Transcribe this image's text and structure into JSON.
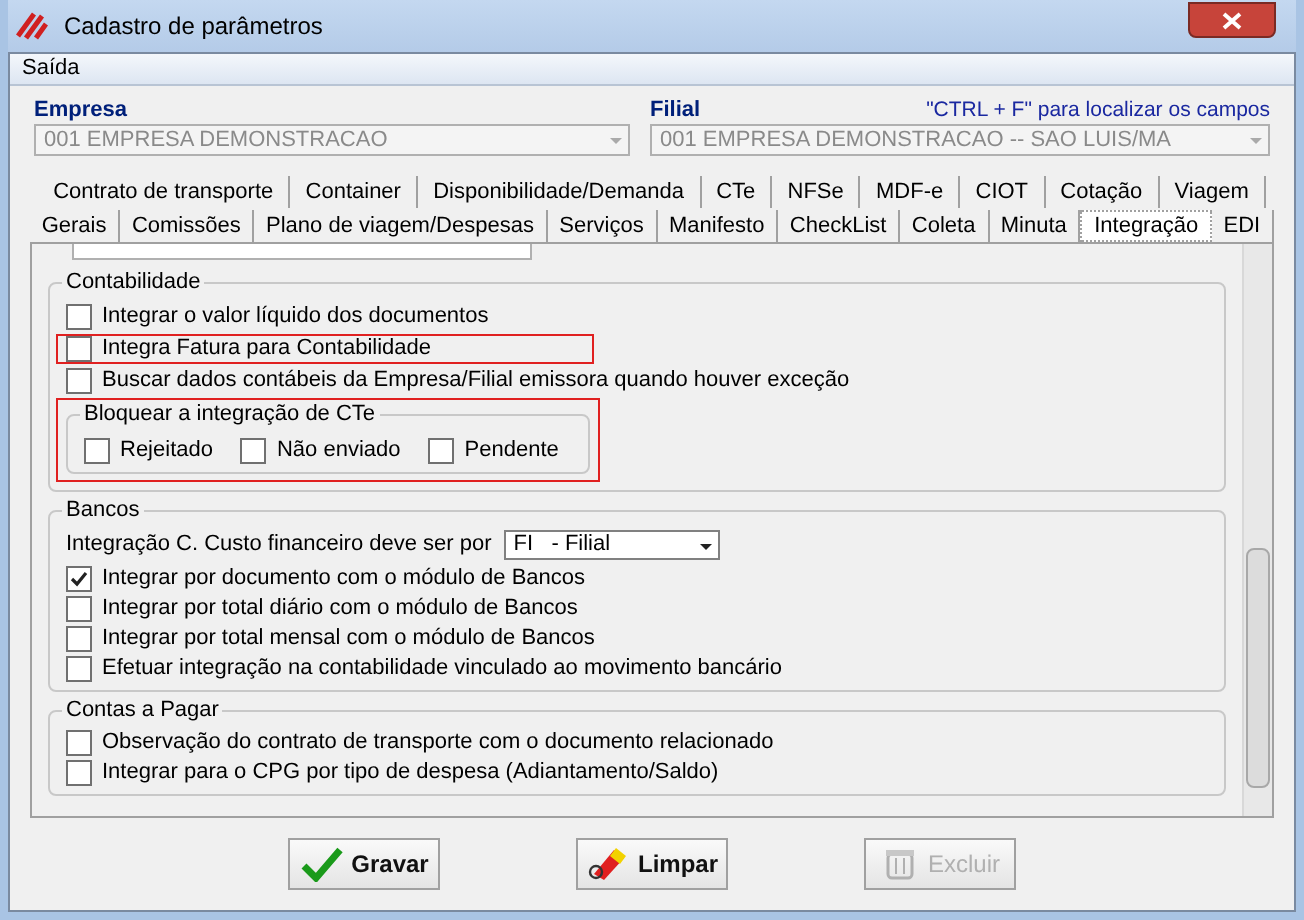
{
  "window": {
    "title": "Cadastro de parâmetros"
  },
  "menu": [
    "Saída"
  ],
  "empresa": {
    "label": "Empresa",
    "value": "001 EMPRESA DEMONSTRACAO"
  },
  "filial": {
    "label": "Filial",
    "value": "001 EMPRESA DEMONSTRACAO -- SAO LUIS/MA",
    "hint": "\"CTRL + F\" para localizar os campos"
  },
  "tabs_row_1": [
    {
      "label": "Contrato de transporte",
      "selected": false
    },
    {
      "label": "Container",
      "selected": false
    },
    {
      "label": "Disponibilidade/Demanda",
      "selected": false
    },
    {
      "label": "CTe",
      "selected": false
    },
    {
      "label": "NFSe",
      "selected": false
    },
    {
      "label": "MDF-e",
      "selected": false
    },
    {
      "label": "CIOT",
      "selected": false
    },
    {
      "label": "Cotação",
      "selected": false
    },
    {
      "label": "Viagem",
      "selected": false
    }
  ],
  "tabs_row_2": [
    {
      "label": "Gerais",
      "selected": false
    },
    {
      "label": "Comissões",
      "selected": false
    },
    {
      "label": "Plano de viagem/Despesas",
      "selected": false
    },
    {
      "label": "Serviços",
      "selected": false
    },
    {
      "label": "Manifesto",
      "selected": false
    },
    {
      "label": "CheckList",
      "selected": false
    },
    {
      "label": "Coleta",
      "selected": false
    },
    {
      "label": "Minuta",
      "selected": false
    },
    {
      "label": "Integração",
      "selected": true
    },
    {
      "label": "EDI",
      "selected": false
    }
  ],
  "contabilidade": {
    "title": "Contabilidade",
    "options": [
      {
        "label": "Integrar o valor líquido dos documentos",
        "checked": false,
        "highlighted": false
      },
      {
        "label": "Integra Fatura para Contabilidade",
        "checked": false,
        "highlighted": true
      },
      {
        "label": "Buscar dados contábeis da Empresa/Filial emissora quando houver exceção",
        "checked": false,
        "highlighted": false
      }
    ],
    "bloquear": {
      "title": "Bloquear a integração de CTe",
      "highlighted": true,
      "options": [
        {
          "label": "Rejeitado",
          "checked": false
        },
        {
          "label": "Não enviado",
          "checked": false
        },
        {
          "label": "Pendente",
          "checked": false
        }
      ]
    }
  },
  "bancos": {
    "title": "Bancos",
    "custo_label": "Integração C. Custo financeiro deve ser por",
    "custo_value": "FI   - Filial",
    "options": [
      {
        "label": "Integrar por documento com o módulo de Bancos",
        "checked": true
      },
      {
        "label": "Integrar por total diário com o módulo de Bancos",
        "checked": false
      },
      {
        "label": "Integrar por total mensal com o módulo de Bancos",
        "checked": false
      },
      {
        "label": "Efetuar integração na contabilidade vinculado ao movimento bancário",
        "checked": false
      }
    ]
  },
  "contas_a_pagar": {
    "title": "Contas a Pagar",
    "options": [
      {
        "label": "Observação do contrato de transporte com o documento relacionado",
        "checked": false
      },
      {
        "label": "Integrar para o CPG por tipo de despesa (Adiantamento/Saldo)",
        "checked": false
      }
    ]
  },
  "buttons": [
    {
      "label": "Gravar",
      "kind": "save",
      "disabled": false
    },
    {
      "label": "Limpar",
      "kind": "clear",
      "disabled": false
    },
    {
      "label": "Excluir",
      "kind": "delete",
      "disabled": true
    }
  ]
}
